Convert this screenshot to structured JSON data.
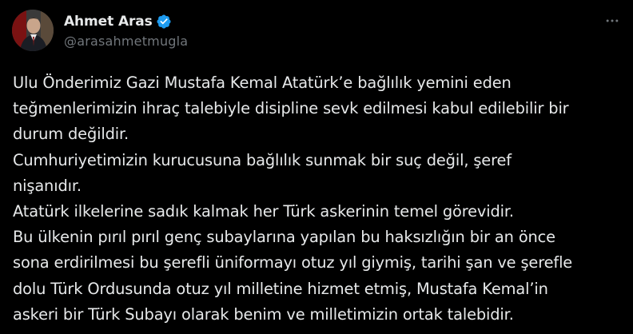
{
  "author": {
    "name": "Ahmet Aras",
    "handle": "@arasahmetmugla",
    "verified": true
  },
  "icons": {
    "verified": "verified-badge-icon",
    "more": "more-options-icon",
    "avatar": "profile-avatar"
  },
  "colors": {
    "background": "#000000",
    "text": "#e7e9ea",
    "secondary": "#71767b",
    "verified": "#1d9bf0"
  },
  "tweet": {
    "lines": [
      "Ulu Önderimiz Gazi Mustafa Kemal Atatürk’e bağlılık yemini eden",
      "teğmenlerimizin ihraç talebiyle disipline sevk edilmesi kabul edilebilir bir",
      "durum değildir.",
      "Cumhuriyetimizin kurucusuna bağlılık sunmak bir suç değil, şeref",
      "nişanıdır.",
      "Atatürk ilkelerine sadık kalmak her Türk askerinin temel görevidir.",
      "Bu ülkenin pırıl pırıl genç subaylarına yapılan bu haksızlığın bir an önce",
      "sona erdirilmesi bu şerefli üniformayı otuz yıl giymiş, tarihi şan ve şerefle",
      "dolu Türk Ordusunda otuz yıl milletine hizmet etmiş, Mustafa Kemal’in",
      "askeri bir Türk Subayı olarak benim ve milletimizin ortak talebidir."
    ]
  }
}
